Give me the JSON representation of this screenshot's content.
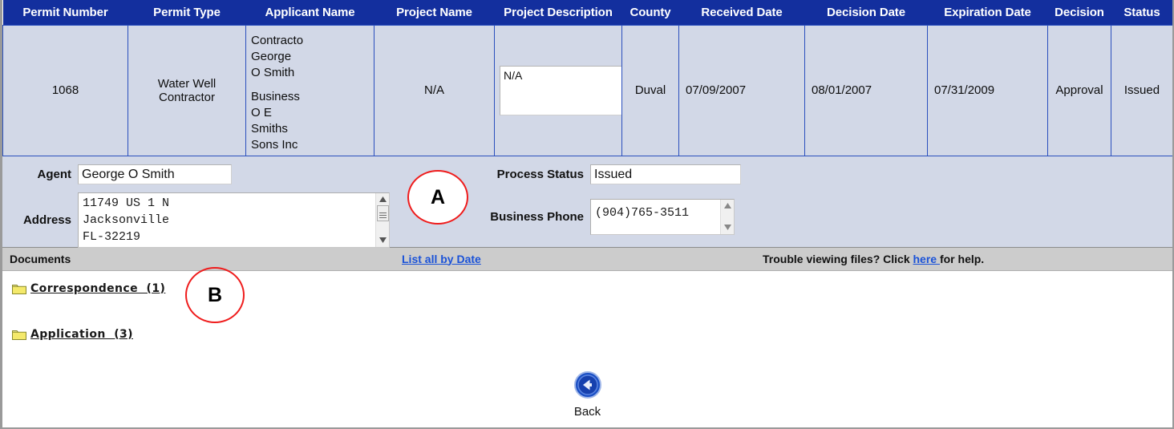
{
  "table": {
    "columns": [
      "Permit Number",
      "Permit Type",
      "Applicant Name",
      "Project Name",
      "Project Description",
      "County",
      "Received Date",
      "Decision Date",
      "Expiration Date",
      "Decision",
      "Status"
    ],
    "row": {
      "permit_number": "1068",
      "permit_type": "Water Well Contractor",
      "applicant_contact": "Contracto\nGeorge\nO Smith",
      "applicant_business": "Business\nO E\nSmiths\nSons Inc",
      "project_name": "N/A",
      "project_description": "N/A",
      "county": "Duval",
      "received_date": "07/09/2007",
      "decision_date": "08/01/2007",
      "expiration_date": "07/31/2009",
      "decision": "Approval",
      "status": "Issued"
    }
  },
  "form": {
    "agent_label": "Agent",
    "agent_value": "George O Smith",
    "address_label": "Address",
    "address_value": "11749 US 1 N\nJacksonville\nFL-32219",
    "process_status_label": "Process Status",
    "process_status_value": "Issued",
    "business_phone_label": "Business Phone",
    "business_phone_value": "(904)765-3511"
  },
  "documents_bar": {
    "title": "Documents",
    "list_link": "List all by Date",
    "help_prefix": "Trouble viewing files? Click ",
    "help_link": "here ",
    "help_suffix": "for help."
  },
  "folders": [
    {
      "label": "Correspondence  (1)",
      "icon": "folder-icon"
    },
    {
      "label": "Application  (3)",
      "icon": "folder-icon"
    }
  ],
  "back": {
    "label": "Back",
    "icon": "back-arrow-icon"
  },
  "annotations": [
    {
      "id": "A",
      "label": "A"
    },
    {
      "id": "B",
      "label": "B"
    }
  ],
  "colors": {
    "header_blue": "#132f9e",
    "row_bg": "#d2d8e7",
    "cell_border": "#2a4fbd",
    "doc_bar_gray": "#cccccc",
    "link_blue": "#1a52d8",
    "annotation_red": "#ef1c1c",
    "folder_yellow": "#f2e55c"
  }
}
